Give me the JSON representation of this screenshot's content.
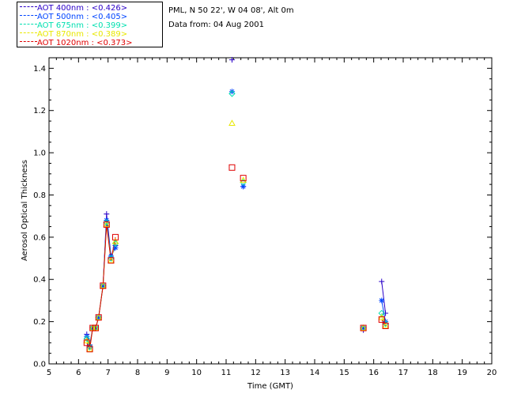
{
  "header": {
    "site": "PML, N 50 22', W 04 08', Alt 0m",
    "date": "Data from: 04 Aug 2001"
  },
  "legend": [
    {
      "label": "AOT  400nm : <0.426>",
      "color": "#2a00c8"
    },
    {
      "label": "AOT  500nm : <0.405>",
      "color": "#0044ff"
    },
    {
      "label": "AOT  675nm : <0.399>",
      "color": "#00e0b0"
    },
    {
      "label": "AOT  870nm : <0.389>",
      "color": "#e8e800"
    },
    {
      "label": "AOT 1020nm : <0.373>",
      "color": "#e00000"
    }
  ],
  "chart_data": {
    "type": "scatter",
    "xlabel": "Time (GMT)",
    "ylabel": "Aerosol Optical Thickness",
    "xlim": [
      5,
      20
    ],
    "ylim": [
      0.0,
      1.45
    ],
    "xticks": [
      "5",
      "6",
      "7",
      "8",
      "9",
      "10",
      "11",
      "12",
      "13",
      "14",
      "15",
      "16",
      "17",
      "18",
      "19",
      "20"
    ],
    "yticks": [
      "0.0",
      "0.2",
      "0.4",
      "0.6",
      "0.8",
      "1.0",
      "1.2",
      "1.4"
    ],
    "series": [
      {
        "name": "AOT  400nm",
        "marker": "plus",
        "color": "#2a00c8",
        "segments": [
          [
            [
              6.28,
              0.14
            ],
            [
              6.38,
              0.09
            ],
            [
              6.48,
              0.17
            ],
            [
              6.58,
              0.17
            ],
            [
              6.68,
              0.22
            ],
            [
              6.83,
              0.37
            ],
            [
              6.95,
              0.71
            ],
            [
              7.1,
              0.51
            ],
            [
              7.25,
              0.56
            ]
          ],
          [
            [
              11.2,
              1.44
            ]
          ],
          [
            [
              11.58,
              0.84
            ]
          ],
          [
            [
              15.65,
              0.16
            ]
          ],
          [
            [
              16.27,
              0.39
            ],
            [
              16.4,
              0.24
            ]
          ]
        ]
      },
      {
        "name": "AOT  500nm",
        "marker": "asterisk",
        "color": "#0044ff",
        "segments": [
          [
            [
              6.28,
              0.13
            ],
            [
              6.38,
              0.08
            ],
            [
              6.48,
              0.17
            ],
            [
              6.58,
              0.17
            ],
            [
              6.68,
              0.22
            ],
            [
              6.83,
              0.37
            ],
            [
              6.95,
              0.68
            ],
            [
              7.1,
              0.51
            ],
            [
              7.25,
              0.55
            ]
          ],
          [
            [
              11.2,
              1.29
            ]
          ],
          [
            [
              11.58,
              0.84
            ]
          ],
          [
            [
              15.65,
              0.17
            ]
          ],
          [
            [
              16.27,
              0.3
            ],
            [
              16.4,
              0.2
            ]
          ]
        ]
      },
      {
        "name": "AOT  675nm",
        "marker": "diamond",
        "color": "#00e0b0",
        "segments": [
          [
            [
              6.28,
              0.12
            ],
            [
              6.38,
              0.08
            ],
            [
              6.48,
              0.17
            ],
            [
              6.58,
              0.17
            ],
            [
              6.68,
              0.22
            ],
            [
              6.83,
              0.37
            ],
            [
              6.95,
              0.67
            ],
            [
              7.1,
              0.5
            ],
            [
              7.25,
              0.57
            ]
          ],
          [
            [
              11.2,
              1.28
            ]
          ],
          [
            [
              11.58,
              0.86
            ]
          ],
          [
            [
              15.65,
              0.17
            ]
          ],
          [
            [
              16.27,
              0.24
            ],
            [
              16.4,
              0.19
            ]
          ]
        ]
      },
      {
        "name": "AOT  870nm",
        "marker": "triangle",
        "color": "#e8e800",
        "segments": [
          [
            [
              6.28,
              0.11
            ],
            [
              6.38,
              0.07
            ],
            [
              6.48,
              0.17
            ],
            [
              6.58,
              0.17
            ],
            [
              6.68,
              0.22
            ],
            [
              6.83,
              0.37
            ],
            [
              6.95,
              0.66
            ],
            [
              7.1,
              0.49
            ],
            [
              7.25,
              0.58
            ]
          ],
          [
            [
              11.2,
              1.14
            ]
          ],
          [
            [
              11.58,
              0.87
            ]
          ],
          [
            [
              15.65,
              0.17
            ]
          ],
          [
            [
              16.27,
              0.22
            ],
            [
              16.4,
              0.18
            ]
          ]
        ]
      },
      {
        "name": "AOT 1020nm",
        "marker": "square",
        "color": "#e00000",
        "segments": [
          [
            [
              6.28,
              0.1
            ],
            [
              6.38,
              0.07
            ],
            [
              6.48,
              0.17
            ],
            [
              6.58,
              0.17
            ],
            [
              6.68,
              0.22
            ],
            [
              6.83,
              0.37
            ],
            [
              6.95,
              0.66
            ],
            [
              7.1,
              0.49
            ],
            [
              7.25,
              0.6
            ]
          ],
          [
            [
              11.2,
              0.93
            ]
          ],
          [
            [
              11.58,
              0.88
            ]
          ],
          [
            [
              15.65,
              0.17
            ]
          ],
          [
            [
              16.27,
              0.21
            ],
            [
              16.4,
              0.18
            ]
          ]
        ]
      }
    ]
  }
}
